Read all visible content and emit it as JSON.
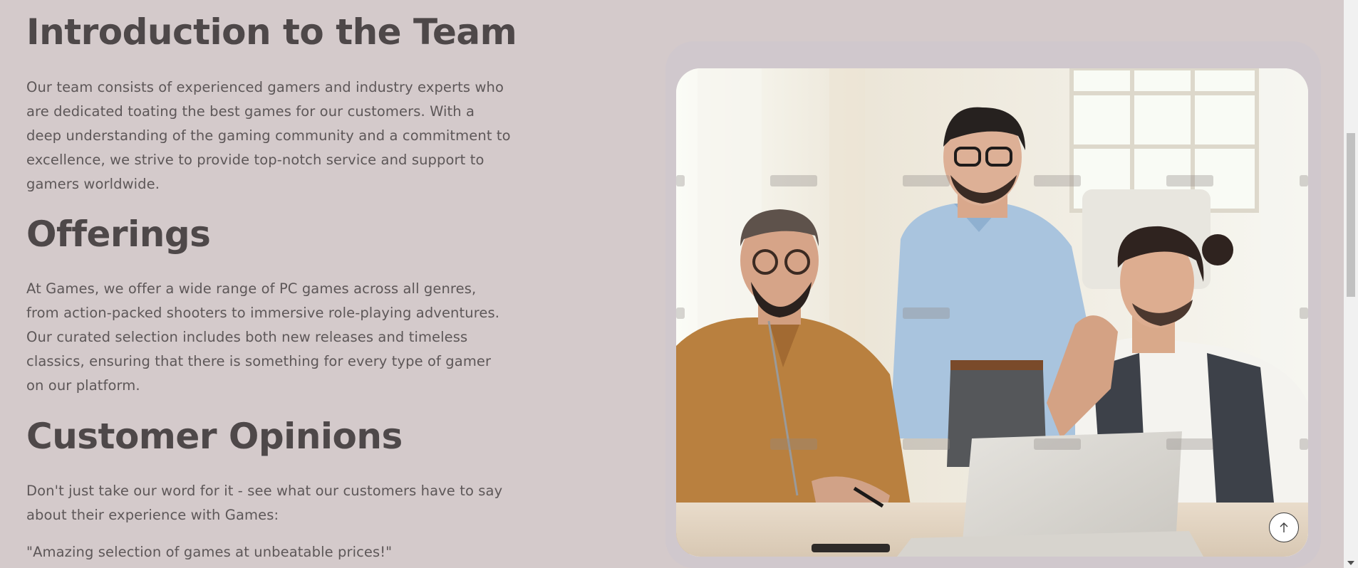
{
  "sections": {
    "team": {
      "heading": "Introduction to the Team",
      "text": "Our team consists of experienced gamers and industry experts who are dedicated toating the best games for our customers. With a deep understanding of the gaming community and a commitment to excellence, we strive to provide top-notch service and support to gamers worldwide."
    },
    "offerings": {
      "heading": "Offerings",
      "text": "At Games, we offer a wide range of PC games across all genres, from action-packed shooters to immersive role-playing adventures. Our curated selection includes both new releases and timeless classics, ensuring that there is something for every type of gamer on our platform."
    },
    "opinions": {
      "heading": "Customer Opinions",
      "text": "Don't just take our word for it - see what our customers have to say about their experience with Games:",
      "quote": "\"Amazing selection of games at unbeatable prices!\""
    }
  },
  "image": {
    "alt": "",
    "icon": "team-photo"
  },
  "back_to_top": {
    "icon": "arrow-up-icon"
  },
  "colors": {
    "background": "#d4cacb",
    "heading": "#4e4849",
    "text": "#5d5758"
  }
}
